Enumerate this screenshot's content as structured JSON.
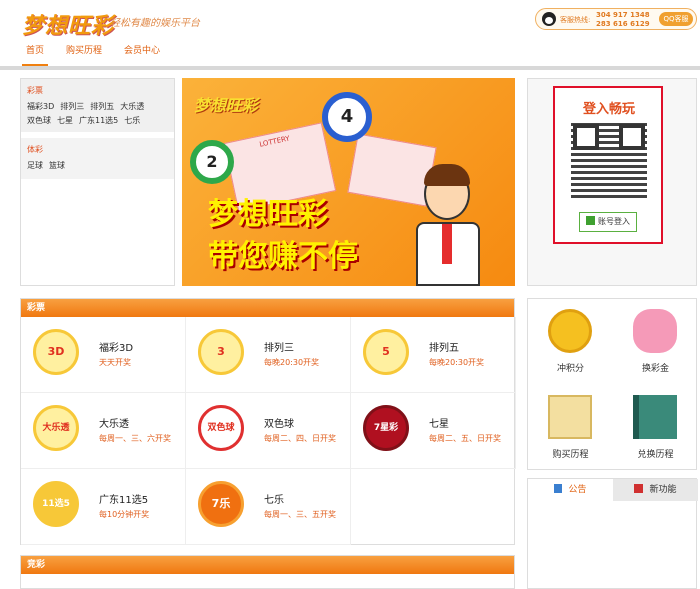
{
  "header": {
    "logo": "梦想旺彩",
    "slogan": "轻松有趣的娱乐平台",
    "hotline_label": "客服热线:",
    "hotline_1": "304 917 1348",
    "hotline_2": "283 616 6129",
    "qq_label": "QQ客服"
  },
  "nav": [
    "首页",
    "购买历程",
    "会员中心"
  ],
  "categories": {
    "lottery_title": "彩票",
    "lottery_row1": [
      "福彩3D",
      "排列三",
      "排列五",
      "大乐透"
    ],
    "lottery_row2": [
      "双色球",
      "七星",
      "广东11选5",
      "七乐"
    ],
    "sports_title": "体彩",
    "sports_row": [
      "足球",
      "篮球"
    ]
  },
  "banner": {
    "logo": "梦想旺彩",
    "line1": "梦想旺彩",
    "line2": "带您赚不停",
    "ticket": "LOTTERY"
  },
  "login": {
    "title": "登入畅玩",
    "button": "账号登入"
  },
  "lottery": {
    "header": "彩票",
    "items": [
      {
        "name": "福彩3D",
        "desc": "天天开奖",
        "icon": "3D"
      },
      {
        "name": "排列三",
        "desc": "每晚20:30开奖",
        "icon": "3"
      },
      {
        "name": "排列五",
        "desc": "每晚20:30开奖",
        "icon": "5"
      },
      {
        "name": "大乐透",
        "desc": "每周一、三、六开奖",
        "icon": "大乐透"
      },
      {
        "name": "双色球",
        "desc": "每周二、四、日开奖",
        "icon": "双色球"
      },
      {
        "name": "七星",
        "desc": "每周二、五、日开奖",
        "icon": "7星彩"
      },
      {
        "name": "广东11选5",
        "desc": "每10分钟开奖",
        "icon": "11选5"
      },
      {
        "name": "七乐",
        "desc": "每周一、三、五开奖",
        "icon": "7乐"
      }
    ]
  },
  "functions": [
    {
      "label": "冲积分",
      "icon": "coin-icon"
    },
    {
      "label": "换彩金",
      "icon": "piggy-bank-icon"
    },
    {
      "label": "购买历程",
      "icon": "shopping-bag-icon"
    },
    {
      "label": "兑换历程",
      "icon": "book-icon"
    }
  ],
  "tabs": [
    "公告",
    "新功能"
  ],
  "jingcai": {
    "header": "竞彩"
  }
}
